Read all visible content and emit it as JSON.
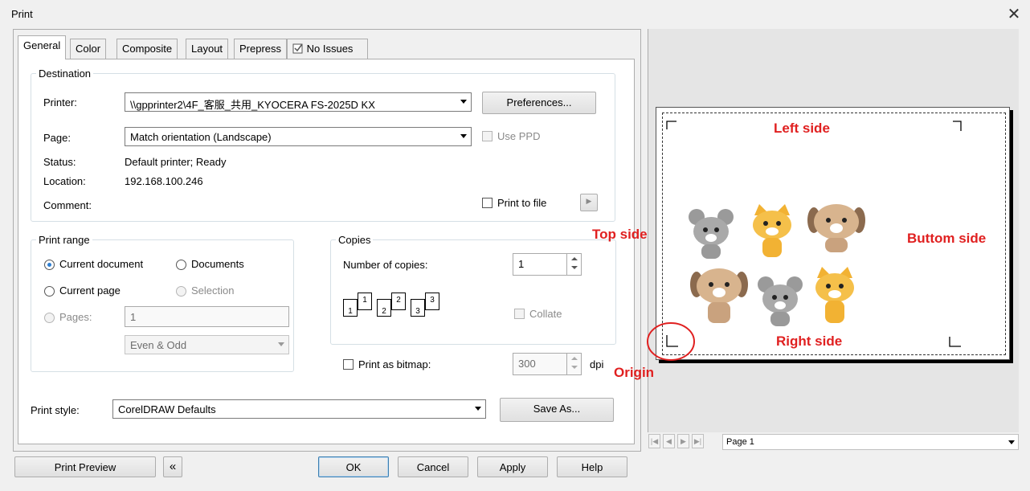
{
  "window": {
    "title": "Print",
    "close_glyph": "✕"
  },
  "tabs": [
    {
      "label": "General"
    },
    {
      "label": "Color"
    },
    {
      "label": "Composite"
    },
    {
      "label": "Layout"
    },
    {
      "label": "Prepress"
    },
    {
      "label": "No Issues",
      "icon": "checklist-icon"
    }
  ],
  "destination": {
    "legend": "Destination",
    "printer_label": "Printer:",
    "printer_value": "\\\\gpprinter2\\4F_客服_共用_KYOCERA FS-2025D KX",
    "preferences_button": "Preferences...",
    "page_label": "Page:",
    "page_value": "Match orientation (Landscape)",
    "use_ppd_label": "Use PPD",
    "status_label": "Status:",
    "status_value": "Default printer; Ready",
    "location_label": "Location:",
    "location_value": "192.168.100.246",
    "comment_label": "Comment:",
    "print_to_file_label": "Print to file",
    "print_to_file_arrow": "▶"
  },
  "print_range": {
    "legend": "Print range",
    "current_document": "Current document",
    "documents": "Documents",
    "current_page": "Current page",
    "selection": "Selection",
    "pages_label": "Pages:",
    "pages_value": "1",
    "even_odd_value": "Even & Odd"
  },
  "copies": {
    "legend": "Copies",
    "number_label": "Number of copies:",
    "number_value": "1",
    "collate_label": "Collate",
    "collate_icons": [
      "1",
      "1",
      "2",
      "2",
      "3",
      "3"
    ]
  },
  "bitmap": {
    "label": "Print as bitmap:",
    "dpi_value": "300",
    "dpi_unit": "dpi"
  },
  "print_style": {
    "label": "Print style:",
    "value": "CorelDRAW Defaults",
    "save_as_button": "Save As..."
  },
  "buttons": {
    "print_preview": "Print Preview",
    "collapse_glyph": "«",
    "ok": "OK",
    "cancel": "Cancel",
    "apply": "Apply",
    "help": "Help"
  },
  "preview": {
    "annotations": {
      "left_side": "Left side",
      "top_side": "Top side",
      "bottom_side": "Buttom side",
      "right_side": "Right side",
      "origin": "Origin"
    },
    "images": [
      "mouse",
      "cat",
      "dog",
      "dog",
      "mouse",
      "cat"
    ],
    "nav": {
      "first": "|◀",
      "prev": "◀",
      "next": "▶",
      "last": "▶|",
      "page_value": "Page 1"
    },
    "colors": {
      "annotation": "#e02020",
      "mouse": "#9a9a9a",
      "cat": "#f2b233",
      "dog": "#c9a27e"
    }
  }
}
